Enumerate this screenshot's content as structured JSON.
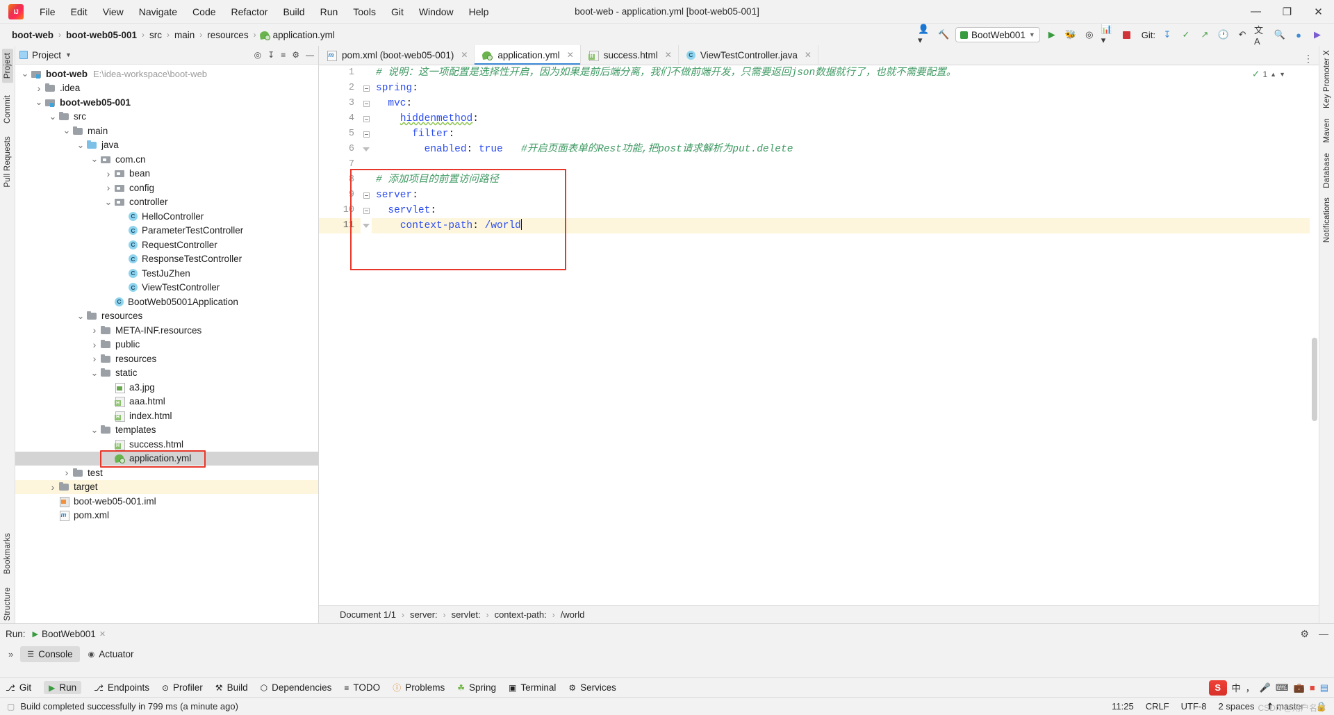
{
  "window": {
    "title": "boot-web - application.yml [boot-web05-001]",
    "logo_icon": "intellij-idea-logo",
    "minimize_icon": "minimize-icon",
    "maximize_icon": "maximize-icon",
    "close_icon": "close-icon",
    "minimize_glyph": "—",
    "maximize_glyph": "❐",
    "close_glyph": "✕"
  },
  "menu": [
    {
      "label": "File"
    },
    {
      "label": "Edit"
    },
    {
      "label": "View"
    },
    {
      "label": "Navigate"
    },
    {
      "label": "Code"
    },
    {
      "label": "Refactor"
    },
    {
      "label": "Build"
    },
    {
      "label": "Run"
    },
    {
      "label": "Tools"
    },
    {
      "label": "Git"
    },
    {
      "label": "Window"
    },
    {
      "label": "Help"
    }
  ],
  "navbar": {
    "crumbs": [
      {
        "label": "boot-web",
        "bold": true
      },
      {
        "label": "boot-web05-001",
        "bold": true
      },
      {
        "label": "src",
        "bold": false
      },
      {
        "label": "main",
        "bold": false
      },
      {
        "label": "resources",
        "bold": false
      },
      {
        "label": "application.yml",
        "bold": false,
        "icon": "yml-file-icon"
      }
    ],
    "separator": "›",
    "run_config": "BootWeb001",
    "git_label": "Git:",
    "icons": [
      "user-settings-icon",
      "hammer-build-icon",
      "run-icon",
      "debug-icon",
      "coverage-icon",
      "profiler-icon",
      "stop-icon",
      "git-update-icon",
      "git-commit-icon",
      "git-push-icon",
      "history-icon",
      "undo-icon",
      "translate-icon",
      "search-icon",
      "account-icon",
      "ide-icon"
    ]
  },
  "left_rail": {
    "top": [
      "Project",
      "Commit",
      "Pull Requests"
    ],
    "bottom": [
      "Bookmarks",
      "Structure"
    ]
  },
  "right_rail": {
    "items": [
      "Key Promoter X",
      "Maven",
      "Database",
      "Notifications"
    ]
  },
  "project_panel": {
    "title": "Project",
    "chevron": "▼",
    "tools": [
      "locate-icon",
      "expand-all-icon",
      "collapse-all-icon",
      "settings-gear-icon",
      "hide-icon"
    ],
    "tree": [
      {
        "label": "boot-web",
        "path": "E:\\idea-workspace\\boot-web",
        "depth": 0,
        "arrow": "down",
        "icon": "module-icon",
        "bold": true
      },
      {
        "label": ".idea",
        "path": "",
        "depth": 1,
        "arrow": "right",
        "icon": "folder-icon",
        "bold": false
      },
      {
        "label": "boot-web05-001",
        "path": "",
        "depth": 1,
        "arrow": "down",
        "icon": "module-icon",
        "bold": true
      },
      {
        "label": "src",
        "path": "",
        "depth": 2,
        "arrow": "down",
        "icon": "folder-icon",
        "bold": false
      },
      {
        "label": "main",
        "path": "",
        "depth": 3,
        "arrow": "down",
        "icon": "folder-icon",
        "bold": false
      },
      {
        "label": "java",
        "path": "",
        "depth": 4,
        "arrow": "down",
        "icon": "source-folder-icon",
        "bold": false
      },
      {
        "label": "com.cn",
        "path": "",
        "depth": 5,
        "arrow": "down",
        "icon": "package-icon",
        "bold": false
      },
      {
        "label": "bean",
        "path": "",
        "depth": 6,
        "arrow": "right",
        "icon": "package-icon",
        "bold": false
      },
      {
        "label": "config",
        "path": "",
        "depth": 6,
        "arrow": "right",
        "icon": "package-icon",
        "bold": false
      },
      {
        "label": "controller",
        "path": "",
        "depth": 6,
        "arrow": "down",
        "icon": "package-icon",
        "bold": false
      },
      {
        "label": "HelloController",
        "path": "",
        "depth": 7,
        "arrow": "none",
        "icon": "java-class-icon",
        "bold": false
      },
      {
        "label": "ParameterTestController",
        "path": "",
        "depth": 7,
        "arrow": "none",
        "icon": "java-class-icon",
        "bold": false
      },
      {
        "label": "RequestController",
        "path": "",
        "depth": 7,
        "arrow": "none",
        "icon": "java-class-icon",
        "bold": false
      },
      {
        "label": "ResponseTestController",
        "path": "",
        "depth": 7,
        "arrow": "none",
        "icon": "java-class-icon",
        "bold": false
      },
      {
        "label": "TestJuZhen",
        "path": "",
        "depth": 7,
        "arrow": "none",
        "icon": "java-class-icon",
        "bold": false
      },
      {
        "label": "ViewTestController",
        "path": "",
        "depth": 7,
        "arrow": "none",
        "icon": "java-class-icon",
        "bold": false
      },
      {
        "label": "BootWeb05001Application",
        "path": "",
        "depth": 6,
        "arrow": "none",
        "icon": "spring-class-icon",
        "bold": false
      },
      {
        "label": "resources",
        "path": "",
        "depth": 4,
        "arrow": "down",
        "icon": "resource-folder-icon",
        "bold": false
      },
      {
        "label": "META-INF.resources",
        "path": "",
        "depth": 5,
        "arrow": "right",
        "icon": "folder-icon",
        "bold": false
      },
      {
        "label": "public",
        "path": "",
        "depth": 5,
        "arrow": "right",
        "icon": "folder-icon",
        "bold": false
      },
      {
        "label": "resources",
        "path": "",
        "depth": 5,
        "arrow": "right",
        "icon": "folder-icon",
        "bold": false
      },
      {
        "label": "static",
        "path": "",
        "depth": 5,
        "arrow": "down",
        "icon": "folder-icon",
        "bold": false
      },
      {
        "label": "a3.jpg",
        "path": "",
        "depth": 6,
        "arrow": "none",
        "icon": "image-file-icon",
        "bold": false
      },
      {
        "label": "aaa.html",
        "path": "",
        "depth": 6,
        "arrow": "none",
        "icon": "html-file-icon",
        "bold": false
      },
      {
        "label": "index.html",
        "path": "",
        "depth": 6,
        "arrow": "none",
        "icon": "html-file-icon",
        "bold": false
      },
      {
        "label": "templates",
        "path": "",
        "depth": 5,
        "arrow": "down",
        "icon": "folder-icon",
        "bold": false
      },
      {
        "label": "success.html",
        "path": "",
        "depth": 6,
        "arrow": "none",
        "icon": "html-file-icon",
        "bold": false
      },
      {
        "label": "application.yml",
        "path": "",
        "depth": 6,
        "arrow": "none",
        "icon": "yml-file-icon",
        "bold": false,
        "selected": true,
        "boxed": true
      },
      {
        "label": "test",
        "path": "",
        "depth": 3,
        "arrow": "right",
        "icon": "folder-icon",
        "bold": false
      },
      {
        "label": "target",
        "path": "",
        "depth": 2,
        "arrow": "right",
        "icon": "folder-icon",
        "bold": false,
        "highlight": true
      },
      {
        "label": "boot-web05-001.iml",
        "path": "",
        "depth": 2,
        "arrow": "none",
        "icon": "iml-file-icon",
        "bold": false
      },
      {
        "label": "pom.xml",
        "path": "",
        "depth": 2,
        "arrow": "none",
        "icon": "maven-xml-icon",
        "bold": false
      }
    ]
  },
  "editor": {
    "tabs": [
      {
        "label": "pom.xml (boot-web05-001)",
        "icon": "maven-xml-icon",
        "active": false
      },
      {
        "label": "application.yml",
        "icon": "yml-file-icon",
        "active": true
      },
      {
        "label": "success.html",
        "icon": "html-file-icon",
        "active": false
      },
      {
        "label": "ViewTestController.java",
        "icon": "java-class-icon",
        "active": false
      }
    ],
    "tab_close_glyph": "✕",
    "inspection_count": "1",
    "inspection_ok_glyph": "✓",
    "lines": [
      {
        "n": "1",
        "fold": "none",
        "segments": [
          {
            "t": "cmt",
            "s": "# 说明：这一项配置是选择性开启，因为如果是前后端分离，我们不做前端开发，只需要返回json数据就行了，也就不需要配置。"
          }
        ]
      },
      {
        "n": "2",
        "fold": "open",
        "segments": [
          {
            "t": "key",
            "s": "spring"
          },
          {
            "t": "punct",
            "s": ":"
          }
        ]
      },
      {
        "n": "3",
        "fold": "open",
        "segments": [
          {
            "t": "plain",
            "s": "  "
          },
          {
            "t": "key",
            "s": "mvc"
          },
          {
            "t": "punct",
            "s": ":"
          }
        ]
      },
      {
        "n": "4",
        "fold": "open",
        "segments": [
          {
            "t": "plain",
            "s": "    "
          },
          {
            "t": "keyu",
            "s": "hiddenmethod"
          },
          {
            "t": "punct",
            "s": ":"
          }
        ]
      },
      {
        "n": "5",
        "fold": "open",
        "segments": [
          {
            "t": "plain",
            "s": "      "
          },
          {
            "t": "key",
            "s": "filter"
          },
          {
            "t": "punct",
            "s": ":"
          }
        ]
      },
      {
        "n": "6",
        "fold": "end",
        "segments": [
          {
            "t": "plain",
            "s": "        "
          },
          {
            "t": "key",
            "s": "enabled"
          },
          {
            "t": "punct",
            "s": ": "
          },
          {
            "t": "val",
            "s": "true"
          },
          {
            "t": "plain",
            "s": "   "
          },
          {
            "t": "cmt",
            "s": "#开启页面表单的Rest功能,把post请求解析为put.delete"
          }
        ]
      },
      {
        "n": "7",
        "fold": "none",
        "segments": []
      },
      {
        "n": "8",
        "fold": "none",
        "segments": [
          {
            "t": "cmt",
            "s": "# 添加项目的前置访问路径"
          }
        ]
      },
      {
        "n": "9",
        "fold": "open",
        "segments": [
          {
            "t": "key",
            "s": "server"
          },
          {
            "t": "punct",
            "s": ":"
          }
        ]
      },
      {
        "n": "10",
        "fold": "open",
        "segments": [
          {
            "t": "plain",
            "s": "  "
          },
          {
            "t": "key",
            "s": "servlet"
          },
          {
            "t": "punct",
            "s": ":"
          }
        ]
      },
      {
        "n": "11",
        "fold": "end",
        "current": true,
        "segments": [
          {
            "t": "plain",
            "s": "    "
          },
          {
            "t": "key",
            "s": "context-path"
          },
          {
            "t": "punct",
            "s": ": "
          },
          {
            "t": "val",
            "s": "/world"
          },
          {
            "t": "caret",
            "s": ""
          }
        ]
      }
    ],
    "breadcrumb": [
      {
        "label": "Document 1/1"
      },
      {
        "label": "server:"
      },
      {
        "label": "servlet:"
      },
      {
        "label": "context-path:"
      },
      {
        "label": "/world"
      }
    ],
    "breadcrumb_sep": "›"
  },
  "run_panel": {
    "label": "Run:",
    "config": "BootWeb001",
    "close_glyph": "✕",
    "play_glyph": "▶",
    "more_glyph": "»",
    "tabs": [
      {
        "label": "Console",
        "icon": "console-icon",
        "selected": true
      },
      {
        "label": "Actuator",
        "icon": "actuator-icon",
        "selected": false
      }
    ],
    "head_icons": [
      "settings-gear-icon",
      "hide-panel-icon"
    ]
  },
  "bottom_bar": {
    "items": [
      {
        "label": "Git",
        "icon": "git-icon",
        "selected": false
      },
      {
        "label": "Run",
        "icon": "run-play-icon",
        "selected": true
      },
      {
        "label": "Endpoints",
        "icon": "endpoints-icon",
        "selected": false
      },
      {
        "label": "Profiler",
        "icon": "profiler-icon",
        "selected": false
      },
      {
        "label": "Build",
        "icon": "build-hammer-icon",
        "selected": false
      },
      {
        "label": "Dependencies",
        "icon": "dependencies-icon",
        "selected": false
      },
      {
        "label": "TODO",
        "icon": "todo-icon",
        "selected": false
      },
      {
        "label": "Problems",
        "icon": "problems-icon",
        "selected": false
      },
      {
        "label": "Spring",
        "icon": "spring-leaf-icon",
        "selected": false
      },
      {
        "label": "Terminal",
        "icon": "terminal-icon",
        "selected": false
      },
      {
        "label": "Services",
        "icon": "services-icon",
        "selected": false
      }
    ],
    "tray": {
      "sogou_label": "S",
      "lang_label": "中",
      "icons": [
        "comma-icon",
        "microphone-icon",
        "keyboard-icon",
        "toolbox-icon",
        "palette-icon",
        "grid-icon"
      ]
    }
  },
  "status_bar": {
    "message": "Build completed successfully in 799 ms (a minute ago)",
    "message_icon": "build-status-icon",
    "time": "11:25",
    "line_sep": "CRLF",
    "encoding": "UTF-8",
    "indent": "2 spaces",
    "branch": "master",
    "branch_icon": "git-branch-icon",
    "lock_icon": "lock-icon",
    "watermark": "CSDN @用户名称"
  },
  "colors": {
    "accent_blue": "#3f8cd9",
    "keyword_blue": "#2b4df0",
    "comment_green": "#3f9a63",
    "highlight_box_red": "#e8372a",
    "current_line": "#fdf6dd",
    "selection_gray": "#d4d4d4"
  }
}
